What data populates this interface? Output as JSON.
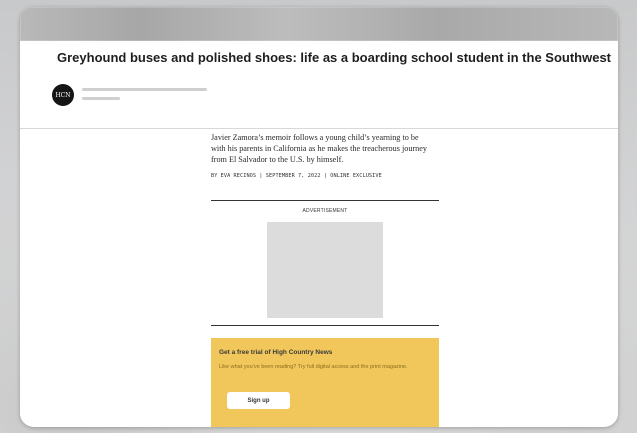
{
  "article": {
    "title": "Greyhound buses and polished shoes: life as a boarding school student in the Southwest",
    "logo_text": "HCN",
    "summary": "Javier Zamora’s memoir follows a young child’s yearning to be with his parents in California as he makes the treacherous journey from El Salvador to the U.S. by himself.",
    "byline": "BY EVA RECINOS | SEPTEMBER 7, 2022 | ONLINE EXCLUSIVE"
  },
  "ad": {
    "label": "ADVERTISEMENT"
  },
  "promo": {
    "title": "Get a free trial of High Country News",
    "text": "Like what you’ve been reading? Try full digital access and the print magazine.",
    "button_label": "Sign up",
    "color": "#f1c75c"
  }
}
